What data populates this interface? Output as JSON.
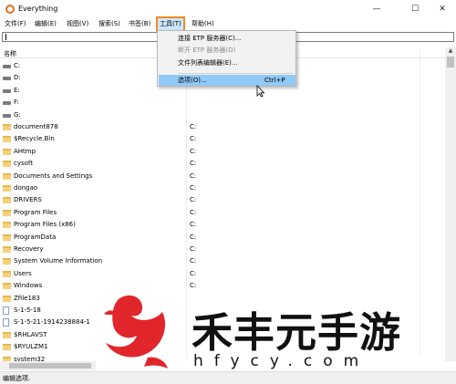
{
  "window": {
    "title": "Everything",
    "minimize": "—",
    "maximize": "☐",
    "close": "✕"
  },
  "menu": [
    {
      "label": "文件(F)",
      "active": false
    },
    {
      "label": "编辑(E)",
      "active": false
    },
    {
      "label": "视图(V)",
      "active": false
    },
    {
      "label": "搜索(S)",
      "active": false
    },
    {
      "label": "书签(B)",
      "active": false
    },
    {
      "label": "工具(T)",
      "active": true
    },
    {
      "label": "帮助(H)",
      "active": false
    }
  ],
  "search": {
    "value": ""
  },
  "columns": {
    "name": "名称"
  },
  "rows": [
    {
      "name": "C:",
      "path": "",
      "icon": "drive-icon"
    },
    {
      "name": "D:",
      "path": "",
      "icon": "drive-icon"
    },
    {
      "name": "E:",
      "path": "",
      "icon": "drive-icon"
    },
    {
      "name": "F:",
      "path": "",
      "icon": "drive-icon"
    },
    {
      "name": "G:",
      "path": "",
      "icon": "drive-icon"
    },
    {
      "name": "document878",
      "path": "C:",
      "icon": "folder-icon"
    },
    {
      "name": "$Recycle.Bin",
      "path": "C:",
      "icon": "folder-icon"
    },
    {
      "name": "AHtmp",
      "path": "C:",
      "icon": "folder-icon"
    },
    {
      "name": "cysoft",
      "path": "C:",
      "icon": "folder-icon"
    },
    {
      "name": "Documents and Settings",
      "path": "C:",
      "icon": "folder-icon"
    },
    {
      "name": "dongao",
      "path": "C:",
      "icon": "folder-icon"
    },
    {
      "name": "DRIVERS",
      "path": "C:",
      "icon": "folder-icon"
    },
    {
      "name": "Program Files",
      "path": "C:",
      "icon": "folder-icon"
    },
    {
      "name": "Program Files (x86)",
      "path": "C:",
      "icon": "folder-icon"
    },
    {
      "name": "ProgramData",
      "path": "C:",
      "icon": "folder-icon"
    },
    {
      "name": "Recovery",
      "path": "C:",
      "icon": "folder-icon"
    },
    {
      "name": "System Volume Information",
      "path": "C:",
      "icon": "folder-icon"
    },
    {
      "name": "Users",
      "path": "C:",
      "icon": "folder-icon"
    },
    {
      "name": "Windows",
      "path": "C:",
      "icon": "folder-icon"
    },
    {
      "name": "Zfile183",
      "path": "",
      "icon": "folder-icon"
    },
    {
      "name": "S-1-5-18",
      "path": "",
      "icon": "file-icon"
    },
    {
      "name": "S-1-5-21-1914238884-1",
      "path": "",
      "icon": "file-icon"
    },
    {
      "name": "$RHLAVST",
      "path": "",
      "icon": "folder-icon"
    },
    {
      "name": "$RYULZM1",
      "path": "",
      "icon": "folder-icon"
    },
    {
      "name": "system32",
      "path": "",
      "icon": "folder-icon"
    }
  ],
  "dropdown": {
    "items": [
      {
        "label": "连接 ETP 服务器(C)...",
        "shortcut": "",
        "disabled": false,
        "hover": false
      },
      {
        "label": "断开 ETP 服务器(D)",
        "shortcut": "",
        "disabled": true,
        "hover": false
      },
      {
        "label": "文件列表编辑器(E)...",
        "shortcut": "",
        "disabled": false,
        "hover": false
      },
      {
        "label": "选项(O)...",
        "shortcut": "Ctrl+P",
        "disabled": false,
        "hover": true
      }
    ]
  },
  "status": {
    "text": "编辑选项."
  },
  "watermark": {
    "title": "禾丰元手游",
    "url": "hfycy.com"
  },
  "colors": {
    "accent_outline": "#f08a24",
    "hover_blue": "#91c9f7",
    "folder": "#f5d27a",
    "logo_red": "#e0262b"
  }
}
